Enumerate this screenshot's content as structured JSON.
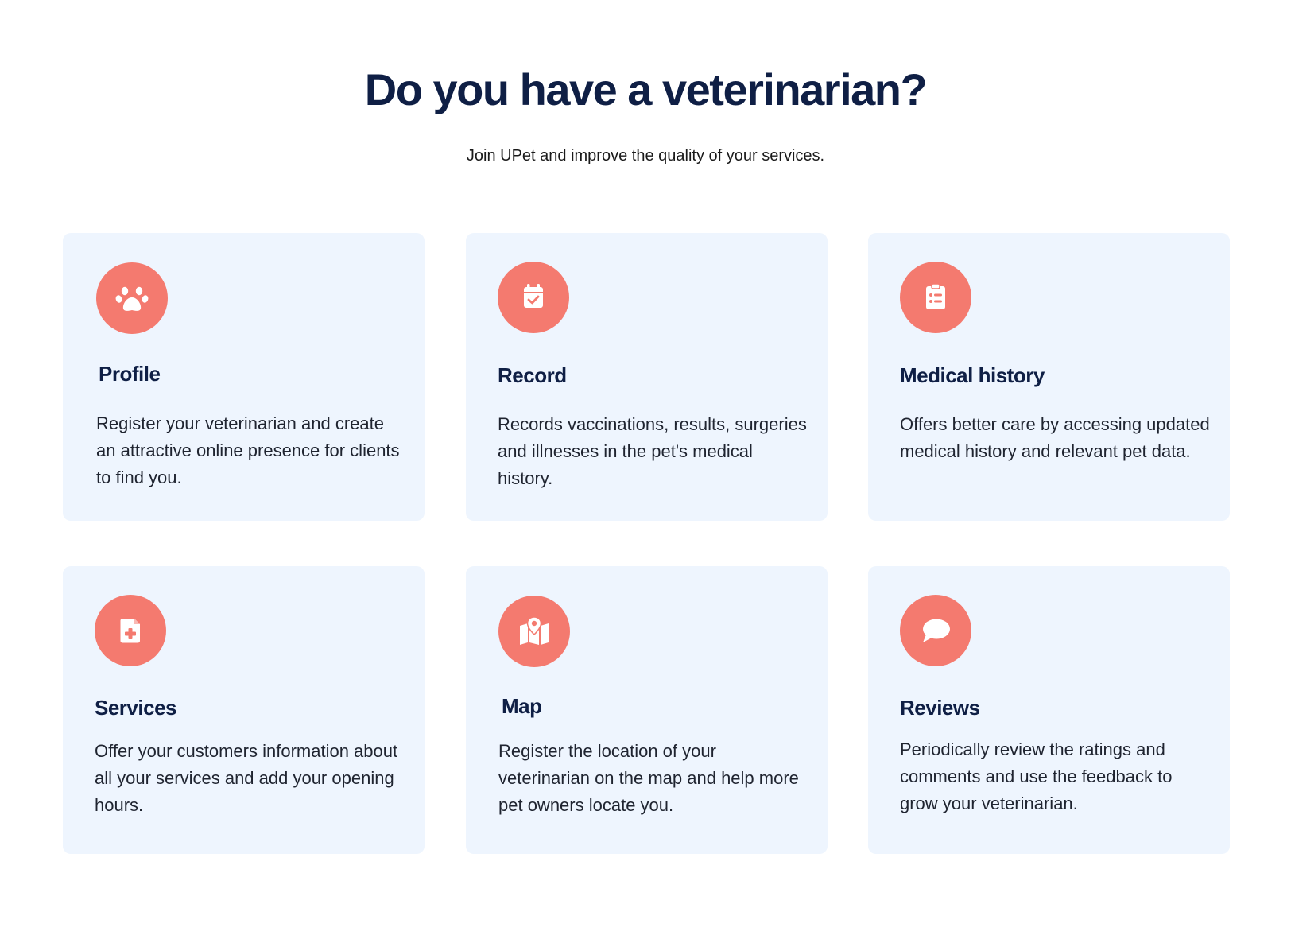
{
  "header": {
    "title": "Do you have a veterinarian?",
    "subtitle": "Join UPet and improve the quality of your services."
  },
  "accent_color": "#f47a6f",
  "card_background": "#eef5fe",
  "features": [
    {
      "icon": "paw-icon",
      "title": "Profile",
      "text": "Register your veterinarian and create an attractive online presence for clients to find you."
    },
    {
      "icon": "calendar-check-icon",
      "title": "Record",
      "text": "Records vaccinations, results, surgeries and illnesses in the pet's medical history."
    },
    {
      "icon": "clipboard-list-icon",
      "title": "Medical history",
      "text": "Offers better care by accessing updated medical history and relevant pet data."
    },
    {
      "icon": "medical-file-icon",
      "title": "Services",
      "text": "Offer your customers information about all your services and add your opening hours."
    },
    {
      "icon": "map-pin-icon",
      "title": "Map",
      "text": "Register the location of your veterinarian on the map and help more pet owners locate you."
    },
    {
      "icon": "speech-bubble-icon",
      "title": "Reviews",
      "text": "Periodically review the ratings and comments and use the feedback to grow your veterinarian."
    }
  ]
}
